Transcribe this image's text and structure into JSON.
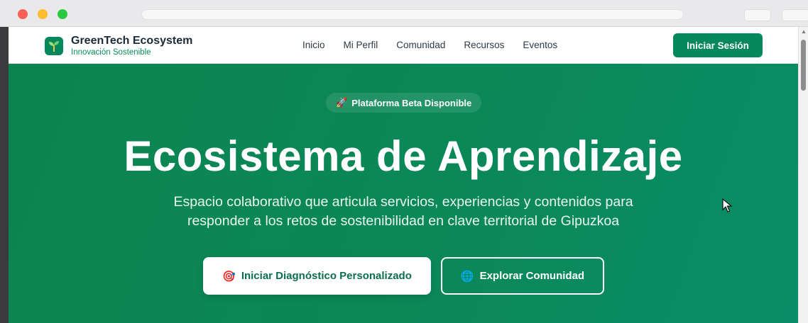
{
  "brand": {
    "title": "GreenTech Ecosystem",
    "subtitle": "Innovación Sostenible"
  },
  "nav": {
    "links": [
      "Inicio",
      "Mi Perfil",
      "Comunidad",
      "Recursos",
      "Eventos"
    ],
    "login_label": "Iniciar Sesión"
  },
  "hero": {
    "badge": "Plataforma Beta Disponible",
    "badge_icon": "🚀",
    "title": "Ecosistema de Aprendizaje",
    "description_line1": "Espacio colaborativo que articula servicios, experiencias y contenidos para",
    "description_line2": "responder a los retos de sostenibilidad en clave territorial de Gipuzkoa",
    "primary_cta": "Iniciar Diagnóstico Personalizado",
    "primary_cta_icon": "🎯",
    "secondary_cta": "Explorar Comunidad",
    "secondary_cta_icon": "🌐"
  },
  "colors": {
    "brand_green": "#07885c",
    "hero_green": "#0b8858",
    "text_dark": "#1c2a36"
  }
}
